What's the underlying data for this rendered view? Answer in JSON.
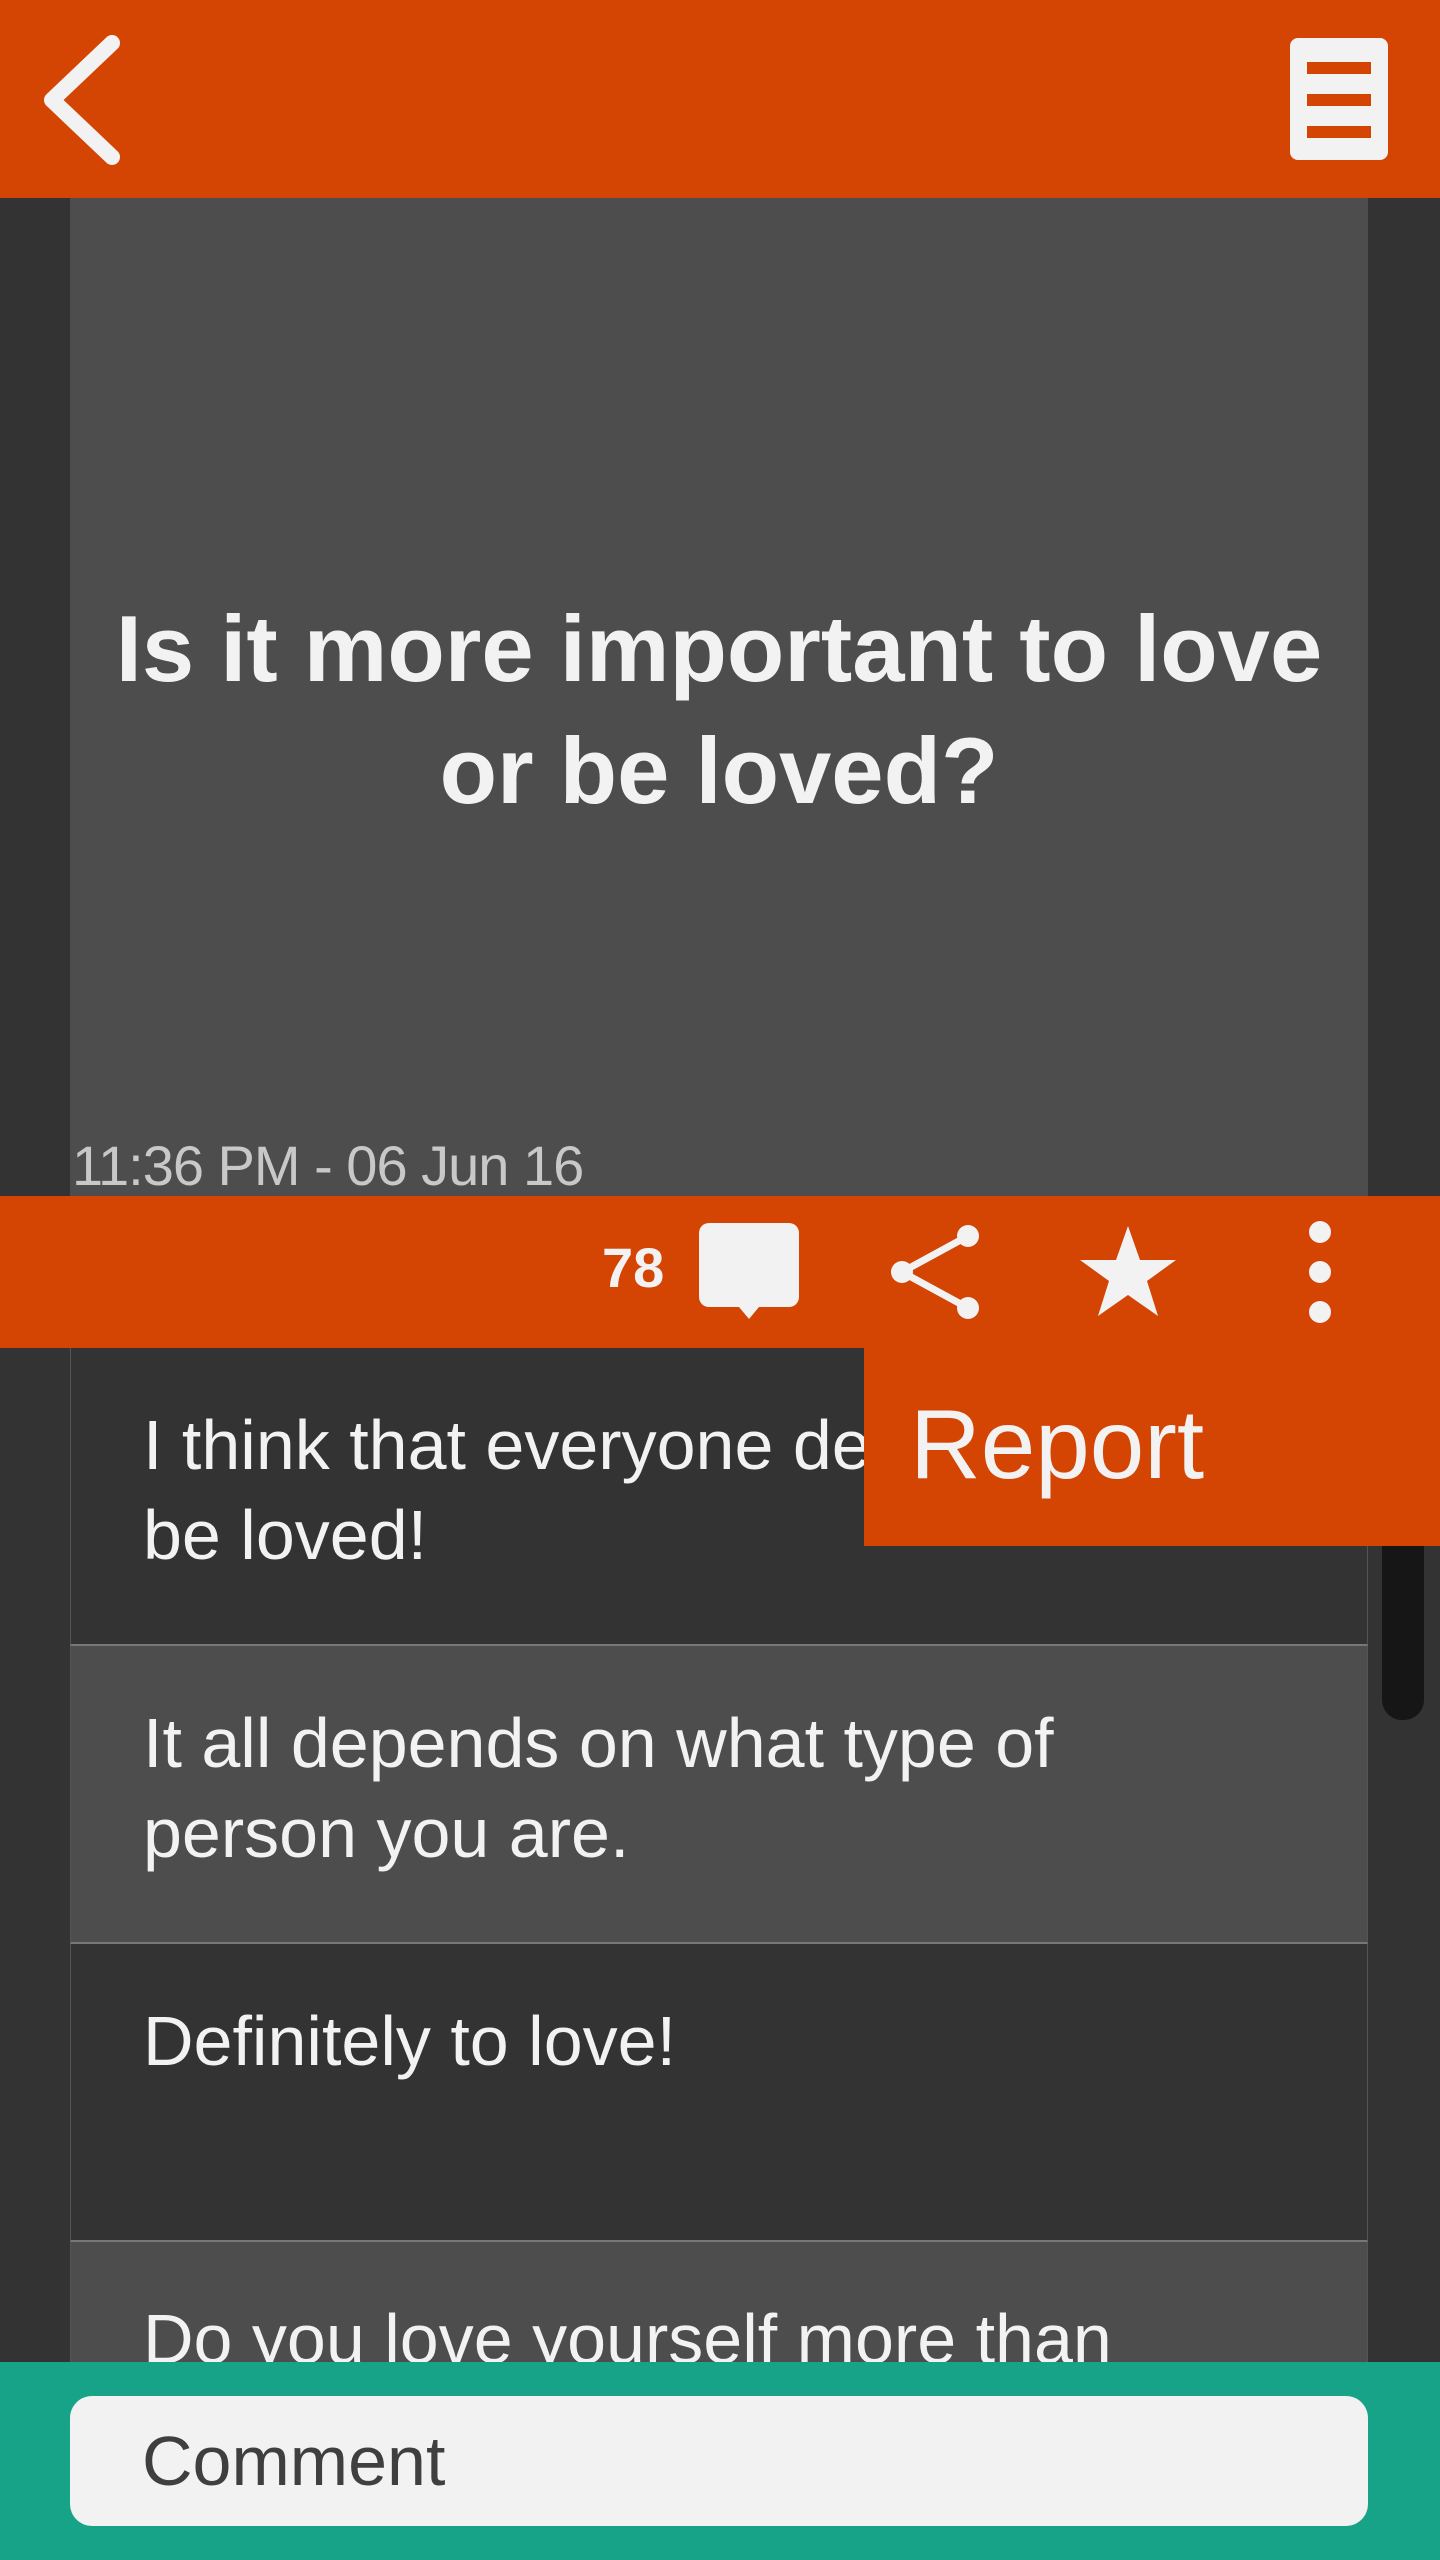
{
  "colors": {
    "accent": "#d44504",
    "card": "#4d4d4d",
    "background": "#333333",
    "bottom_bar": "#16a387",
    "text_light": "#f2f2f2"
  },
  "header": {
    "back_icon": "chevron-left-icon",
    "menu_icon": "list-menu-icon"
  },
  "question": {
    "text": "Is it more important to love or be loved?",
    "timestamp": "11:36 PM - 06 Jun 16"
  },
  "actions": {
    "comment_count": "78",
    "icons": [
      "comment-icon",
      "share-icon",
      "star-icon",
      "more-vertical-icon"
    ]
  },
  "comments": [
    {
      "text": "I think that everyone deserves to be loved!"
    },
    {
      "text": "It all depends on what type of person you are."
    },
    {
      "text": "Definitely to love!"
    },
    {
      "text": "Do you love yourself more than"
    }
  ],
  "overflow_menu": {
    "items": [
      {
        "label": "Report"
      }
    ]
  },
  "comment_box": {
    "placeholder": "Comment"
  }
}
